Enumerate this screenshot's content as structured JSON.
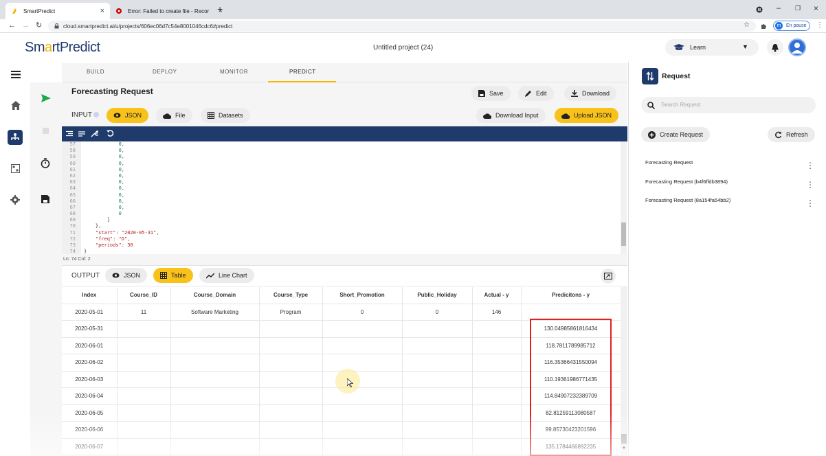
{
  "browser": {
    "tabs": [
      {
        "title": "SmartPredict",
        "active": true
      },
      {
        "title": "Error: Failed to create file - Recor",
        "active": false
      }
    ],
    "url": "cloud.smartpredict.ai/u/projects/606ec06d7c54e8001046cdc6#predict",
    "profile_badge": "En pause",
    "profile_initial": "m"
  },
  "header": {
    "logo_left": "Sm",
    "logo_mid": "a",
    "logo_right": "rtPredict",
    "project_title": "Untitled project (24)",
    "learn_label": "Learn"
  },
  "nav": {
    "tabs": [
      "BUILD",
      "DEPLOY",
      "MONITOR",
      "PREDICT"
    ],
    "active": "PREDICT"
  },
  "request": {
    "title": "Forecasting Request",
    "save_label": "Save",
    "edit_label": "Edit",
    "download_label": "Download",
    "input_label": "INPUT",
    "input_tabs": {
      "json": "JSON",
      "file": "File",
      "datasets": "Datasets"
    },
    "download_input_label": "Download Input",
    "upload_json_label": "Upload JSON"
  },
  "editor": {
    "lines": [
      {
        "n": "57",
        "t": "            0,"
      },
      {
        "n": "58",
        "t": "            0,"
      },
      {
        "n": "59",
        "t": "            0,"
      },
      {
        "n": "60",
        "t": "            0,"
      },
      {
        "n": "61",
        "t": "            0,"
      },
      {
        "n": "62",
        "t": "            0,"
      },
      {
        "n": "63",
        "t": "            0,"
      },
      {
        "n": "64",
        "t": "            0,"
      },
      {
        "n": "65",
        "t": "            0,"
      },
      {
        "n": "66",
        "t": "            0,"
      },
      {
        "n": "67",
        "t": "            0,"
      },
      {
        "n": "68",
        "t": "            0"
      },
      {
        "n": "69",
        "t": "        ]"
      },
      {
        "n": "70",
        "t": "    },"
      },
      {
        "n": "71",
        "t": "    \"start\": \"2020-05-31\","
      },
      {
        "n": "72",
        "t": "    \"freq\": \"D\","
      },
      {
        "n": "73",
        "t": "    \"periods\": 30"
      },
      {
        "n": "74",
        "t": "}"
      }
    ],
    "status": "Ln: 74   Col: 2"
  },
  "output": {
    "label": "OUTPUT",
    "tabs": {
      "json": "JSON",
      "table": "Table",
      "line_chart": "Line Chart"
    },
    "active_tab": "Table"
  },
  "table": {
    "columns": [
      "Index",
      "Course_ID",
      "Course_Domain",
      "Course_Type",
      "Short_Promotion",
      "Public_Holiday",
      "Actual - y",
      "Predicitons - y"
    ],
    "rows": [
      [
        "2020-05-01",
        "11",
        "Software Marketing",
        "Program",
        "0",
        "0",
        "146",
        ""
      ],
      [
        "2020-05-31",
        "",
        "",
        "",
        "",
        "",
        "",
        "130.04985861816434"
      ],
      [
        "2020-06-01",
        "",
        "",
        "",
        "",
        "",
        "",
        "118.7811789985712"
      ],
      [
        "2020-06-02",
        "",
        "",
        "",
        "",
        "",
        "",
        "116.35366431550094"
      ],
      [
        "2020-06-03",
        "",
        "",
        "",
        "",
        "",
        "",
        "110.19361986771435"
      ],
      [
        "2020-06-04",
        "",
        "",
        "",
        "",
        "",
        "",
        "114.84907232389709"
      ],
      [
        "2020-06-05",
        "",
        "",
        "",
        "",
        "",
        "",
        "82.81259113080587"
      ],
      [
        "2020-06-06",
        "",
        "",
        "",
        "",
        "",
        "",
        "99.85730423201596"
      ],
      [
        "2020-06-07",
        "",
        "",
        "",
        "",
        "",
        "",
        "135.1784466892235"
      ]
    ]
  },
  "right_panel": {
    "title": "Request",
    "search_placeholder": "Search Request",
    "create_label": "Create Request",
    "refresh_label": "Refresh",
    "items": [
      "Forecasting Request",
      "Forecasting Request (b4f6ffdb3894)",
      "Forecasting Request (8a154fa54bb2)"
    ]
  },
  "colors": {
    "accent_yellow": "#f8c21a",
    "navy": "#1f3b6b",
    "highlight_red": "#e02020"
  }
}
